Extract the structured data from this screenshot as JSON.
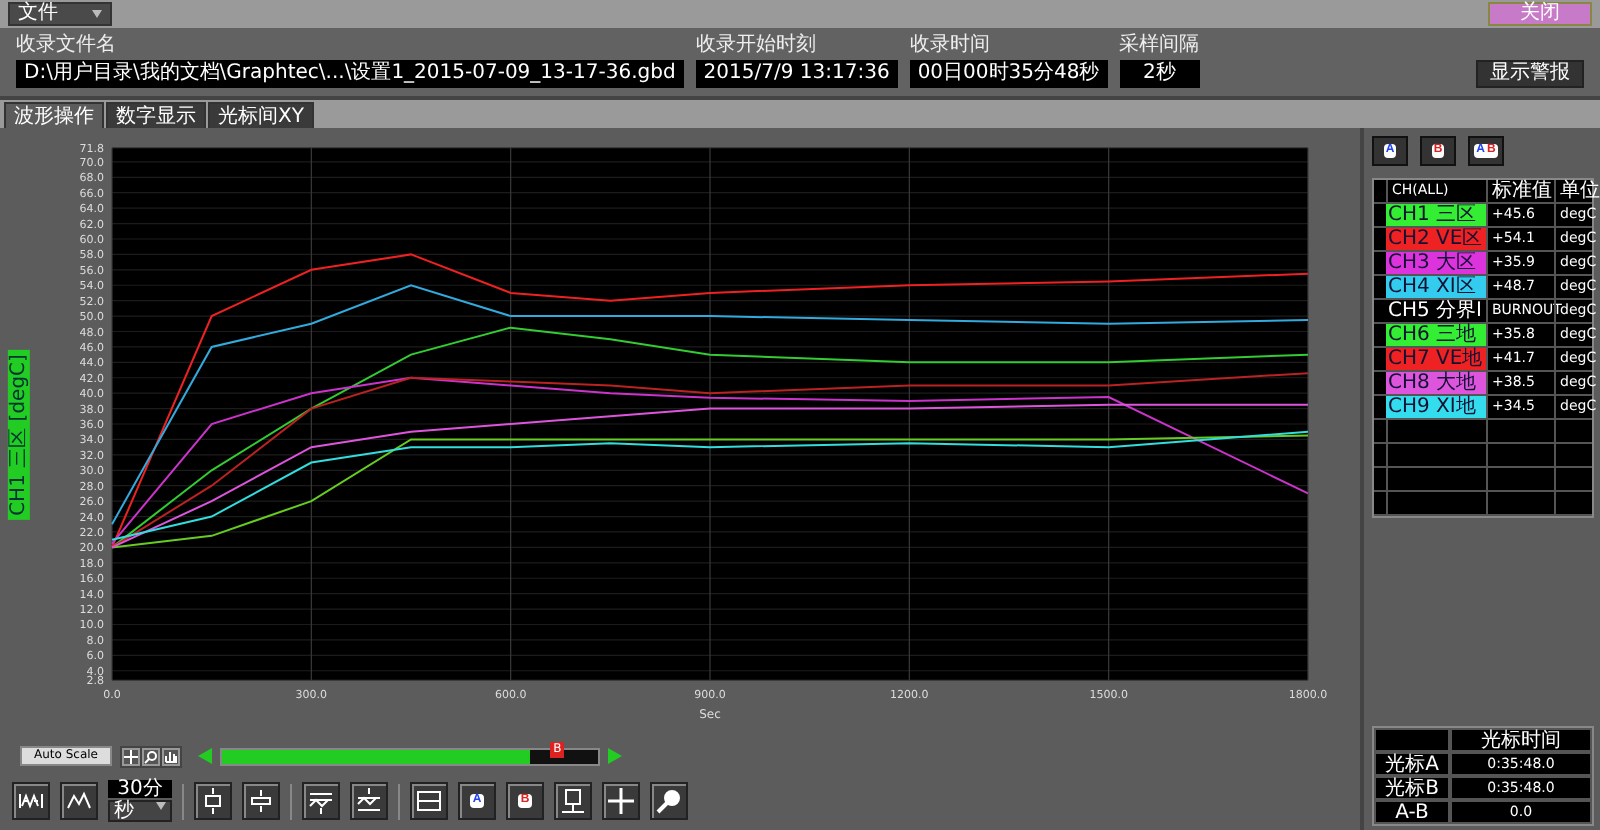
{
  "menu": {
    "label": "文件"
  },
  "close_button": "关闭",
  "info": {
    "fields": [
      {
        "label": "收录文件名",
        "value": "D:\\用户目录\\我的文档\\Graphtec\\...\\设置1_2015-07-09_13-17-36.gbd"
      },
      {
        "label": "收录开始时刻",
        "value": "2015/7/9 13:17:36"
      },
      {
        "label": "收录时间",
        "value": "00日00时35分48秒"
      },
      {
        "label": "采样间隔",
        "value": "2秒"
      }
    ]
  },
  "alarm_button": "显示警报",
  "tabs": [
    {
      "label": "波形操作",
      "selected": true
    },
    {
      "label": "数字显示",
      "selected": false
    },
    {
      "label": "光标间XY",
      "selected": false
    }
  ],
  "chart": {
    "y_axis_label": "CH1 三区 [degC]",
    "chart_data": {
      "type": "line",
      "grid": true,
      "xlabel": "Sec",
      "x": [
        0,
        150,
        300,
        450,
        600,
        750,
        900,
        1200,
        1500,
        1800
      ],
      "xlim": [
        0,
        1800
      ],
      "ylim": [
        2.8,
        71.8
      ],
      "xticks": [
        {
          "value": 0,
          "label": "0.0"
        },
        {
          "value": 300,
          "label": "300.0"
        },
        {
          "value": 600,
          "label": "600.0"
        },
        {
          "value": 900,
          "label": "900.0"
        },
        {
          "value": 1200,
          "label": "1200.0"
        },
        {
          "value": 1500,
          "label": "1500.0"
        },
        {
          "value": 1800,
          "label": "1800.0"
        }
      ],
      "yticks": [
        {
          "value": 2.8,
          "label": "2.8"
        },
        {
          "value": 4,
          "label": "4.0"
        },
        {
          "value": 6,
          "label": "6.0"
        },
        {
          "value": 8,
          "label": "8.0"
        },
        {
          "value": 10,
          "label": "10.0"
        },
        {
          "value": 12,
          "label": "12.0"
        },
        {
          "value": 14,
          "label": "14.0"
        },
        {
          "value": 16,
          "label": "16.0"
        },
        {
          "value": 18,
          "label": "18.0"
        },
        {
          "value": 20,
          "label": "20.0"
        },
        {
          "value": 22,
          "label": "22.0"
        },
        {
          "value": 24,
          "label": "24.0"
        },
        {
          "value": 26,
          "label": "26.0"
        },
        {
          "value": 28,
          "label": "28.0"
        },
        {
          "value": 30,
          "label": "30.0"
        },
        {
          "value": 32,
          "label": "32.0"
        },
        {
          "value": 34,
          "label": "34.0"
        },
        {
          "value": 36,
          "label": "36.0"
        },
        {
          "value": 38,
          "label": "38.0"
        },
        {
          "value": 40,
          "label": "40.0"
        },
        {
          "value": 42,
          "label": "42.0"
        },
        {
          "value": 44,
          "label": "44.0"
        },
        {
          "value": 46,
          "label": "46.0"
        },
        {
          "value": 48,
          "label": "48.0"
        },
        {
          "value": 50,
          "label": "50.0"
        },
        {
          "value": 52,
          "label": "52.0"
        },
        {
          "value": 54,
          "label": "54.0"
        },
        {
          "value": 56,
          "label": "56.0"
        },
        {
          "value": 58,
          "label": "58.0"
        },
        {
          "value": 60,
          "label": "60.0"
        },
        {
          "value": 62,
          "label": "62.0"
        },
        {
          "value": 64,
          "label": "64.0"
        },
        {
          "value": 66,
          "label": "66.0"
        },
        {
          "value": 68,
          "label": "68.0"
        },
        {
          "value": 70,
          "label": "70.0"
        },
        {
          "value": 71.8,
          "label": "71.8"
        }
      ],
      "series": [
        {
          "color": "#33cc33",
          "values": [
            20,
            30,
            38,
            45,
            48.5,
            47,
            45,
            44,
            44,
            45
          ]
        },
        {
          "color": "#ee2222",
          "values": [
            20,
            50,
            56,
            58,
            53,
            52,
            53,
            54,
            54.5,
            55.5
          ]
        },
        {
          "color": "#cc33cc",
          "values": [
            20.5,
            36,
            40,
            42,
            41,
            40,
            39.4,
            39,
            39.5,
            27
          ]
        },
        {
          "color": "#33aadd",
          "values": [
            23,
            46,
            49,
            54,
            50,
            50,
            50,
            49.5,
            49,
            49.5
          ]
        },
        {
          "color": "#66cc22",
          "values": [
            20,
            21.5,
            26,
            34,
            34,
            34,
            34,
            34,
            34,
            34.5
          ]
        },
        {
          "color": "#bb2222",
          "values": [
            20,
            28,
            38,
            42,
            41.5,
            41,
            40,
            41,
            41,
            42.6
          ]
        },
        {
          "color": "#dd55dd",
          "values": [
            20,
            26,
            33,
            35,
            36,
            37,
            38,
            38,
            38.5,
            38.5
          ]
        },
        {
          "color": "#33dddd",
          "values": [
            21,
            24,
            31,
            33,
            33,
            33.5,
            33,
            33.5,
            33,
            35
          ]
        }
      ]
    }
  },
  "cursor_buttons": [
    {
      "letters": [
        "A"
      ]
    },
    {
      "letters": [
        "B"
      ]
    },
    {
      "letters": [
        "A",
        "B"
      ]
    }
  ],
  "channel_table": {
    "columns": [
      "CH(ALL)",
      "标准值",
      "单位"
    ],
    "rows": [
      {
        "channel": "CH1 三区",
        "color": "#33ee33",
        "value": "+45.6",
        "unit": "degC"
      },
      {
        "channel": "CH2 VE区",
        "color": "#ee2222",
        "value": "+54.1",
        "unit": "degC"
      },
      {
        "channel": "CH3 大区",
        "color": "#dd33dd",
        "value": "+35.9",
        "unit": "degC"
      },
      {
        "channel": "CH4 XI区",
        "color": "#33ccee",
        "value": "+48.7",
        "unit": "degC"
      },
      {
        "channel": "CH5 分界I",
        "color": "#000000",
        "value": "BURNOUT",
        "unit": "degC"
      },
      {
        "channel": "CH6 三地",
        "color": "#33ee33",
        "value": "+35.8",
        "unit": "degC"
      },
      {
        "channel": "CH7 VE地",
        "color": "#ee2222",
        "value": "+41.7",
        "unit": "degC"
      },
      {
        "channel": "CH8 大地",
        "color": "#dd55dd",
        "value": "+38.5",
        "unit": "degC"
      },
      {
        "channel": "CH9 XI地",
        "color": "#33ddee",
        "value": "+34.5",
        "unit": "degC"
      }
    ]
  },
  "cursor_table": {
    "columns": [
      "光标时间"
    ],
    "rows": [
      {
        "label": "光标A",
        "value": "0:35:48.0"
      },
      {
        "label": "光标B",
        "value": "0:35:48.0"
      },
      {
        "label": "A-B",
        "value": "0.0"
      }
    ]
  },
  "controls": {
    "auto_scale": "Auto Scale",
    "scroll": {
      "level": 0.82
    },
    "cursor_marker": "B",
    "span_value": "30分",
    "span_unit": "秒",
    "cursor_a": "A",
    "cursor_b": "B"
  }
}
